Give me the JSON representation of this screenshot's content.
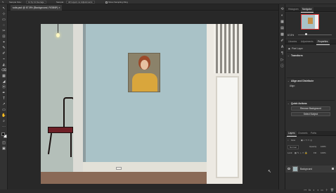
{
  "options": {
    "sample_size_label": "Sample Size:",
    "sample_size_value": "11 by 11 Average",
    "sample_label": "Sample:",
    "sample_value": "All Layers no Adjustments",
    "show_ring_label": "Show Sampling Ring"
  },
  "document": {
    "tab_title": "sofa.psd @ 67.8% (Background, RGB/8*)",
    "close_glyph": "×"
  },
  "tools": [
    "↖",
    "⊹",
    "▭",
    "◌",
    "✂",
    "⊡",
    "⌖",
    "✎",
    "✐",
    "⌁",
    "◭",
    "⌫",
    "▦",
    "◢",
    "⦿",
    "✒",
    "T",
    "↗",
    "▭",
    "✋",
    "⌕",
    "⋯"
  ],
  "colors": {
    "foreground": "#111111",
    "background": "#f2f2f2",
    "accent": "#2d8ceb"
  },
  "panel": {
    "top_tabs": [
      "Histogram",
      "Navigator"
    ],
    "zoom": "67.8%",
    "mid_tabs": [
      "Libraries",
      "Adjustments",
      "Properties"
    ],
    "pixel_layer_label": "Pixel Layer",
    "transform_heading": "Transform",
    "align_heading": "Align and Distribute",
    "align_label": "Align:",
    "quick_actions_heading": "Quick Actions",
    "remove_bg_button": "Remove Background",
    "select_subject_button": "Select Subject",
    "layer_tabs": [
      "Layers",
      "Channels",
      "Paths"
    ],
    "kind_label": "Kind",
    "blend_mode": "Normal",
    "opacity_label": "Opacity:",
    "opacity_value": "100%",
    "lock_label": "Lock:",
    "fill_label": "Fill:",
    "fill_value": "100%",
    "layer_name": "Background",
    "bottom_icons": [
      "⊶",
      "fx",
      "◐",
      "◑",
      "▭",
      "＋",
      "🗑"
    ]
  }
}
